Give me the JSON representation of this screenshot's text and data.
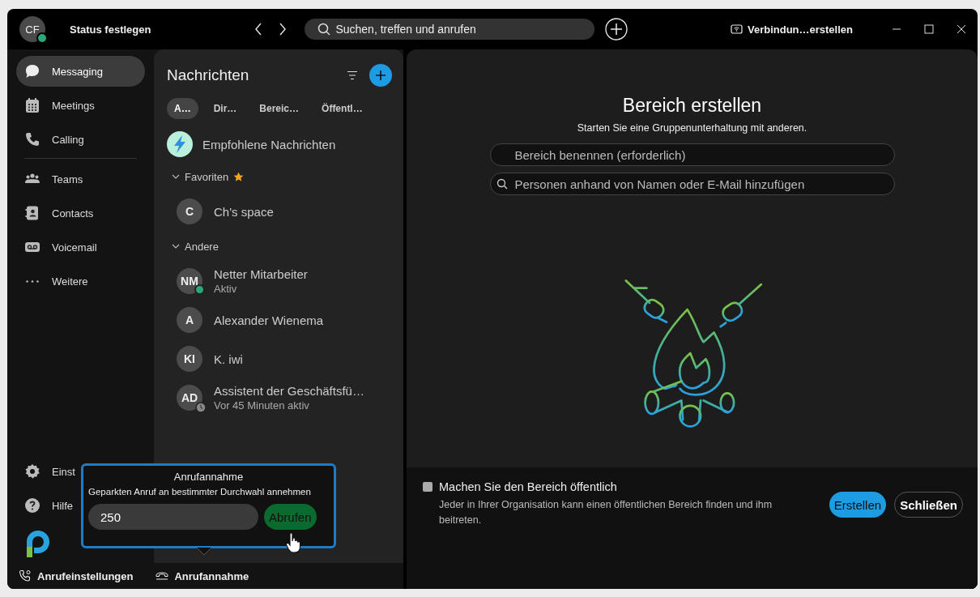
{
  "titlebar": {
    "avatar_initials": "CF",
    "status": "Status festlegen",
    "search_placeholder": "Suchen, treffen und anrufen",
    "connection": "Verbindun…erstellen"
  },
  "nav": [
    {
      "label": "Messaging",
      "kind": "chat",
      "selected": true
    },
    {
      "label": "Meetings",
      "kind": "calendar",
      "selected": false
    },
    {
      "label": "Calling",
      "kind": "phone",
      "selected": false
    },
    {
      "label": "Teams",
      "kind": "team",
      "selected": false
    },
    {
      "label": "Contacts",
      "kind": "contact",
      "selected": false
    },
    {
      "label": "Voicemail",
      "kind": "voicemail",
      "selected": false
    },
    {
      "label": "Weitere",
      "kind": "more",
      "selected": false
    }
  ],
  "nav_bottom": [
    {
      "label": "Einst",
      "kind": "settings"
    },
    {
      "label": "Hilfe",
      "kind": "help"
    }
  ],
  "messages": {
    "title": "Nachrichten",
    "filters": [
      {
        "label": "A…",
        "selected": true
      },
      {
        "label": "Dir…",
        "selected": false
      },
      {
        "label": "Bereic…",
        "selected": false
      },
      {
        "label": "Öffentl…",
        "selected": false
      }
    ],
    "recommended": "Empfohlene Nachrichten",
    "sections": [
      {
        "title": "Favoriten",
        "starred": true,
        "expanded": true,
        "items": [
          {
            "initials": "C",
            "name": "Ch's space",
            "online": false,
            "idle": false
          }
        ]
      },
      {
        "title": "Andere",
        "starred": false,
        "expanded": true,
        "items": [
          {
            "initials": "NM",
            "name": "Netter Mitarbeiter",
            "subtitle": "Aktiv",
            "online": true,
            "idle": false
          },
          {
            "initials": "A",
            "name": "Alexander Wienema",
            "online": false,
            "idle": false
          },
          {
            "initials": "KI",
            "name": "K. iwi",
            "online": false,
            "idle": false
          },
          {
            "initials": "AD",
            "name": "Assistent der Geschäftsfü…",
            "subtitle": "Vor 45 Minuten aktiv",
            "online": false,
            "idle": true
          }
        ]
      }
    ]
  },
  "create_space": {
    "title": "Bereich erstellen",
    "subtitle": "Starten Sie eine Gruppenunterhaltung mit anderen.",
    "name_placeholder": "Bereich benennen (erforderlich)",
    "people_placeholder": "Personen anhand von Namen oder E-Mail hinzufügen",
    "public": {
      "label": "Machen Sie den Bereich öffentlich",
      "description": "Jeder in Ihrer Organisation kann einen öffentlichen Bereich finden und ihm beitreten.",
      "checked": false
    },
    "buttons": [
      {
        "label": "Erstellen",
        "kind": "primary"
      },
      {
        "label": "Schließen",
        "kind": "secondary"
      }
    ]
  },
  "footer": [
    {
      "label": "Anrufeinstellungen",
      "kind": "settings"
    },
    {
      "label": "Anrufannahme",
      "kind": "pickup"
    }
  ],
  "popup": {
    "title": "Anrufannahme",
    "description": "Geparkten Anruf an bestimmter Durchwahl annehmen",
    "value": "250",
    "button": "Abrufen"
  }
}
